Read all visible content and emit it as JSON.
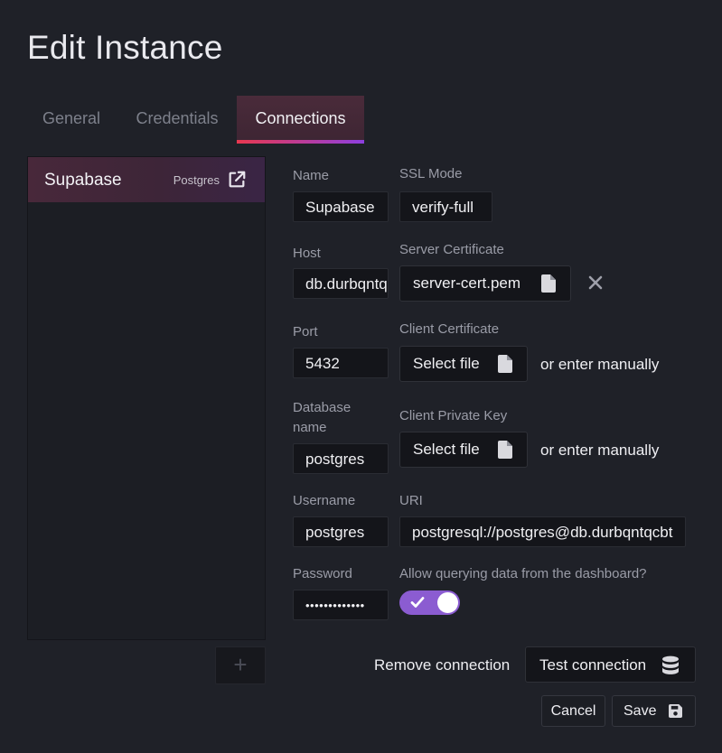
{
  "page": {
    "title": "Edit Instance"
  },
  "tabs": [
    {
      "label": "General",
      "active": false
    },
    {
      "label": "Credentials",
      "active": false
    },
    {
      "label": "Connections",
      "active": true
    }
  ],
  "connections": {
    "items": [
      {
        "name": "Supabase",
        "type": "Postgres",
        "selected": true
      }
    ],
    "add_label": "+"
  },
  "form": {
    "name": {
      "label": "Name",
      "value": "Supabase"
    },
    "host": {
      "label": "Host",
      "value": "db.durbqntqcbt"
    },
    "port": {
      "label": "Port",
      "value": "5432"
    },
    "database": {
      "label": "Database name",
      "value": "postgres"
    },
    "username": {
      "label": "Username",
      "value": "postgres"
    },
    "password": {
      "label": "Password",
      "value": "•••••••••••••"
    },
    "ssl_mode": {
      "label": "SSL Mode",
      "value": "verify-full"
    },
    "server_cert": {
      "label": "Server Certificate",
      "value": "server-cert.pem"
    },
    "client_cert": {
      "label": "Client Certificate",
      "button": "Select file",
      "alt": "or enter manually"
    },
    "client_key": {
      "label": "Client Private Key",
      "button": "Select file",
      "alt": "or enter manually"
    },
    "uri": {
      "label": "URI",
      "value": "postgresql://postgres@db.durbqntqcbt"
    },
    "allow_query": {
      "label": "Allow querying data from the dashboard?",
      "enabled": true
    }
  },
  "actions": {
    "remove": "Remove connection",
    "test": "Test connection",
    "cancel": "Cancel",
    "save": "Save"
  },
  "icons": {
    "external_link": "external-link-icon",
    "file": "file-icon",
    "close": "close-icon",
    "check": "check-icon",
    "database": "database-icon",
    "save": "save-icon"
  },
  "colors": {
    "background": "#1f2128",
    "tab_active_gradient": [
      "#e8384f",
      "#8d3fe0"
    ],
    "toggle_on": "#8b5cd1"
  }
}
